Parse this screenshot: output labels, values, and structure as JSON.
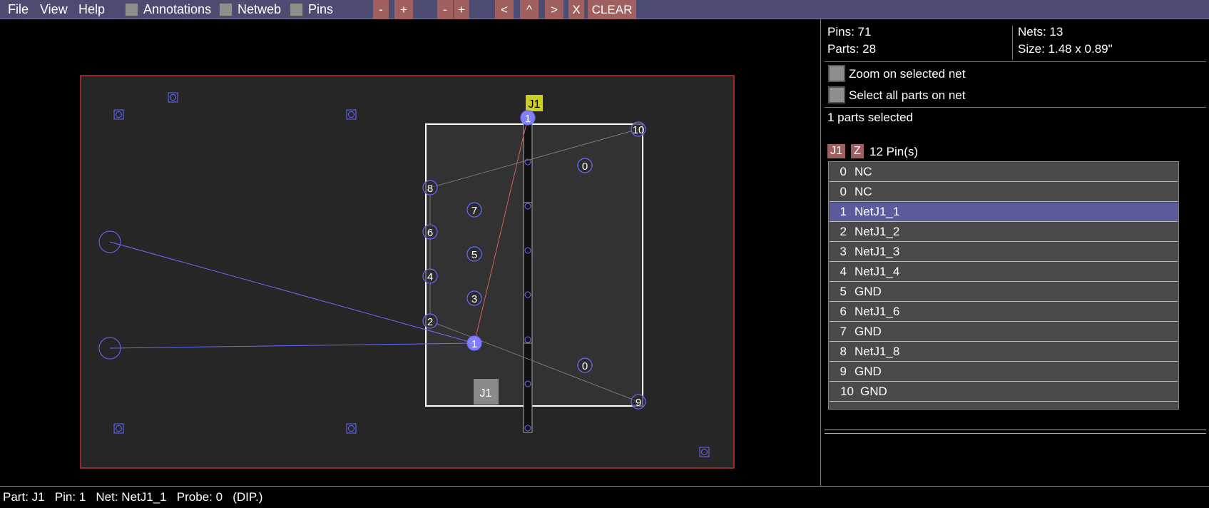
{
  "menu": {
    "file": "File",
    "view": "View",
    "help": "Help",
    "annotations": "Annotations",
    "netweb": "Netweb",
    "pins": "Pins"
  },
  "toolbar": {
    "minus1": "-",
    "plus1": "+",
    "minus2": "-",
    "plus2": "+",
    "prev": "<",
    "up": "^",
    "next": ">",
    "close": "X",
    "clear": "CLEAR"
  },
  "board": {
    "part_label": "J1",
    "part_tag": "J1",
    "pin_labels": [
      "1",
      "10",
      "0",
      "8",
      "7",
      "6",
      "5",
      "4",
      "3",
      "2",
      "1",
      "0",
      "9"
    ]
  },
  "stats": {
    "pins": "Pins: 71",
    "parts": "Parts: 28",
    "nets": "Nets: 13",
    "size": "Size: 1.48 x 0.89\""
  },
  "options": {
    "zoom_on_net": "Zoom on selected net",
    "select_all_on_net": "Select all parts on net"
  },
  "selection": {
    "summary": "1 parts selected",
    "part_tag": "J1",
    "z_tag": "Z",
    "pin_count": "12 Pin(s)"
  },
  "pins_list": [
    {
      "num": "0",
      "net": "NC"
    },
    {
      "num": "0",
      "net": "NC"
    },
    {
      "num": "1",
      "net": "NetJ1_1",
      "selected": true
    },
    {
      "num": "2",
      "net": "NetJ1_2"
    },
    {
      "num": "3",
      "net": "NetJ1_3"
    },
    {
      "num": "4",
      "net": "NetJ1_4"
    },
    {
      "num": "5",
      "net": "GND"
    },
    {
      "num": "6",
      "net": "NetJ1_6"
    },
    {
      "num": "7",
      "net": "GND"
    },
    {
      "num": "8",
      "net": "NetJ1_8"
    },
    {
      "num": "9",
      "net": "GND"
    },
    {
      "num": "10",
      "net": "GND"
    }
  ],
  "status": {
    "text": "Part: J1   Pin: 1   Net: NetJ1_1   Probe: 0   (DIP.)"
  },
  "colors": {
    "menubar": "#4c4c72",
    "board_fill": "#262626",
    "board_outline": "#c03030",
    "pin_ring": "#6a6aff",
    "pin_selected": "#8080ff",
    "part_tag_bg": "#cccc22",
    "row_selected": "#5c5c9c"
  }
}
